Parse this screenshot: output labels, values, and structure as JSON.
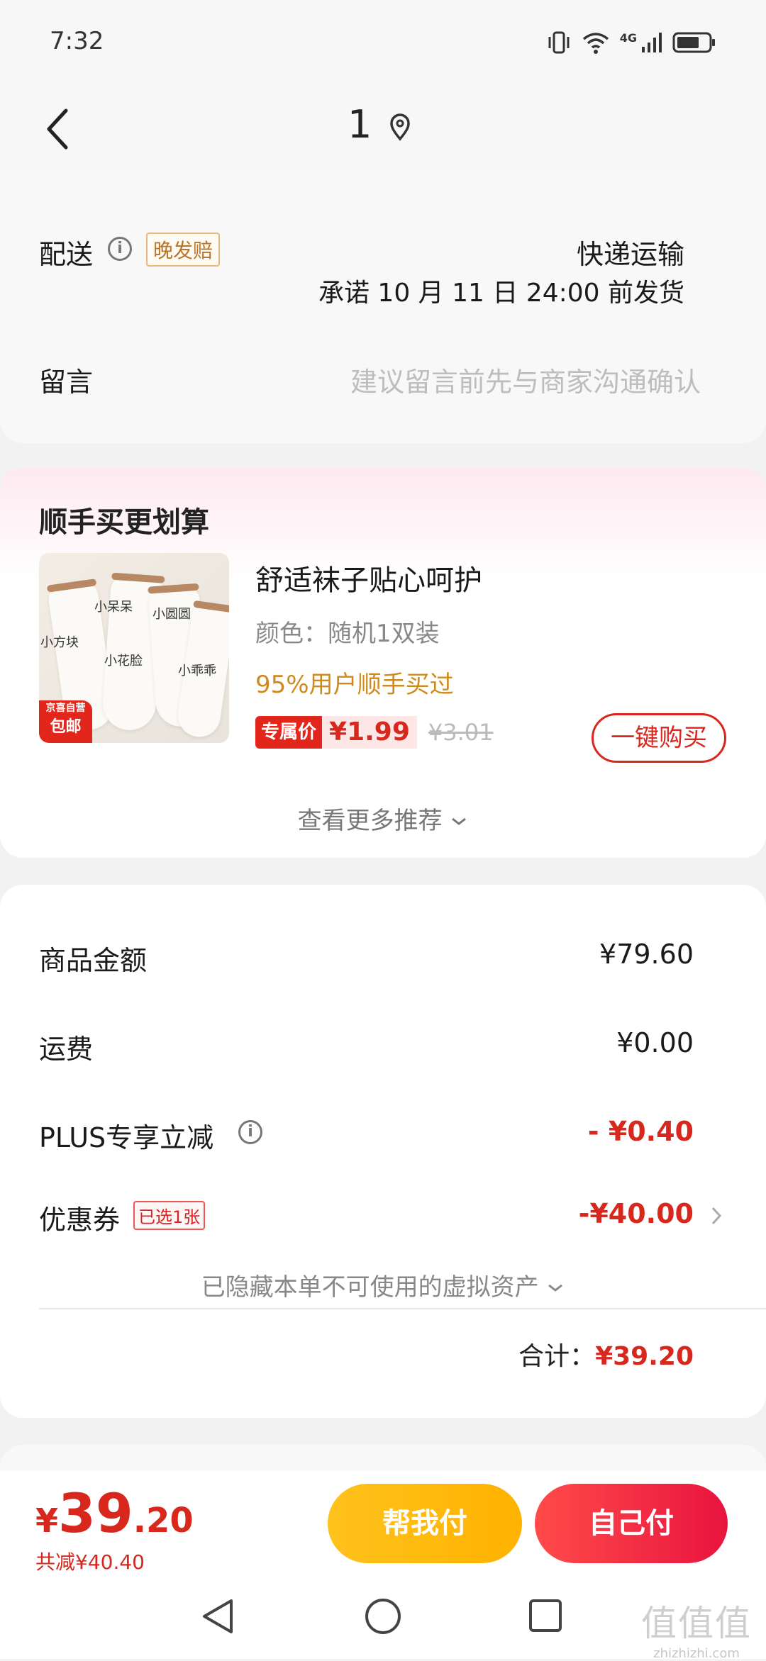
{
  "status_bar": {
    "time": "7:32",
    "network": "4G"
  },
  "header": {
    "title": "1"
  },
  "delivery": {
    "label": "配送",
    "late_tag": "晚发赔",
    "method": "快递运输",
    "promise": "承诺 10 月 11 日 24:00 前发货"
  },
  "message": {
    "label": "留言",
    "placeholder": "建议留言前先与商家沟通确认"
  },
  "addon": {
    "section_title": "顺手买更划算",
    "product_name": "舒适袜子贴心呵护",
    "spec": "颜色：随机1双装",
    "social_proof": "95%用户顺手买过",
    "exclusive_label": "专属价",
    "price": "¥1.99",
    "original_price": "¥3.01",
    "buy_button": "一键购买",
    "more": "查看更多推荐",
    "thumb_badge_line1": "京喜自营",
    "thumb_badge_line2": "包邮",
    "thumb_texts": [
      "小呆呆",
      "小圆圆",
      "小方块",
      "小花脸",
      "小乖乖"
    ]
  },
  "summary": {
    "goods_label": "商品金额",
    "goods_value": "¥79.60",
    "shipping_label": "运费",
    "shipping_value": "¥0.00",
    "plus_label": "PLUS专享立减",
    "plus_value": "- ¥0.40",
    "coupon_label": "优惠券",
    "coupon_tag": "已选1张",
    "coupon_value": "-¥40.00",
    "hidden_assets": "已隐藏本单不可使用的虚拟资产",
    "total_label": "合计：",
    "total_value": "¥39.20"
  },
  "bottom_bar": {
    "currency": "¥",
    "price_int": "39",
    "price_dec": ".20",
    "saved": "共减¥40.40",
    "pay_for_me": "帮我付",
    "pay_self": "自己付"
  },
  "watermark": "值值值",
  "watermark_sub": "zhizhizhi.com",
  "colors": {
    "accent_red": "#d8271c",
    "yellow": "#ffc21c"
  }
}
